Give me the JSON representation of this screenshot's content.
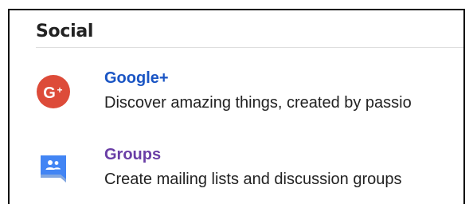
{
  "section": {
    "title": "Social"
  },
  "items": [
    {
      "title": "Google+",
      "description": "Discover amazing things, created by passio",
      "icon": "google-plus-icon",
      "title_color": "#1a55c4",
      "icon_color": "#dd4b39"
    },
    {
      "title": "Groups",
      "description": "Create mailing lists and discussion groups",
      "icon": "groups-icon",
      "title_color": "#6a3ea6",
      "icon_color": "#4285f4"
    }
  ]
}
